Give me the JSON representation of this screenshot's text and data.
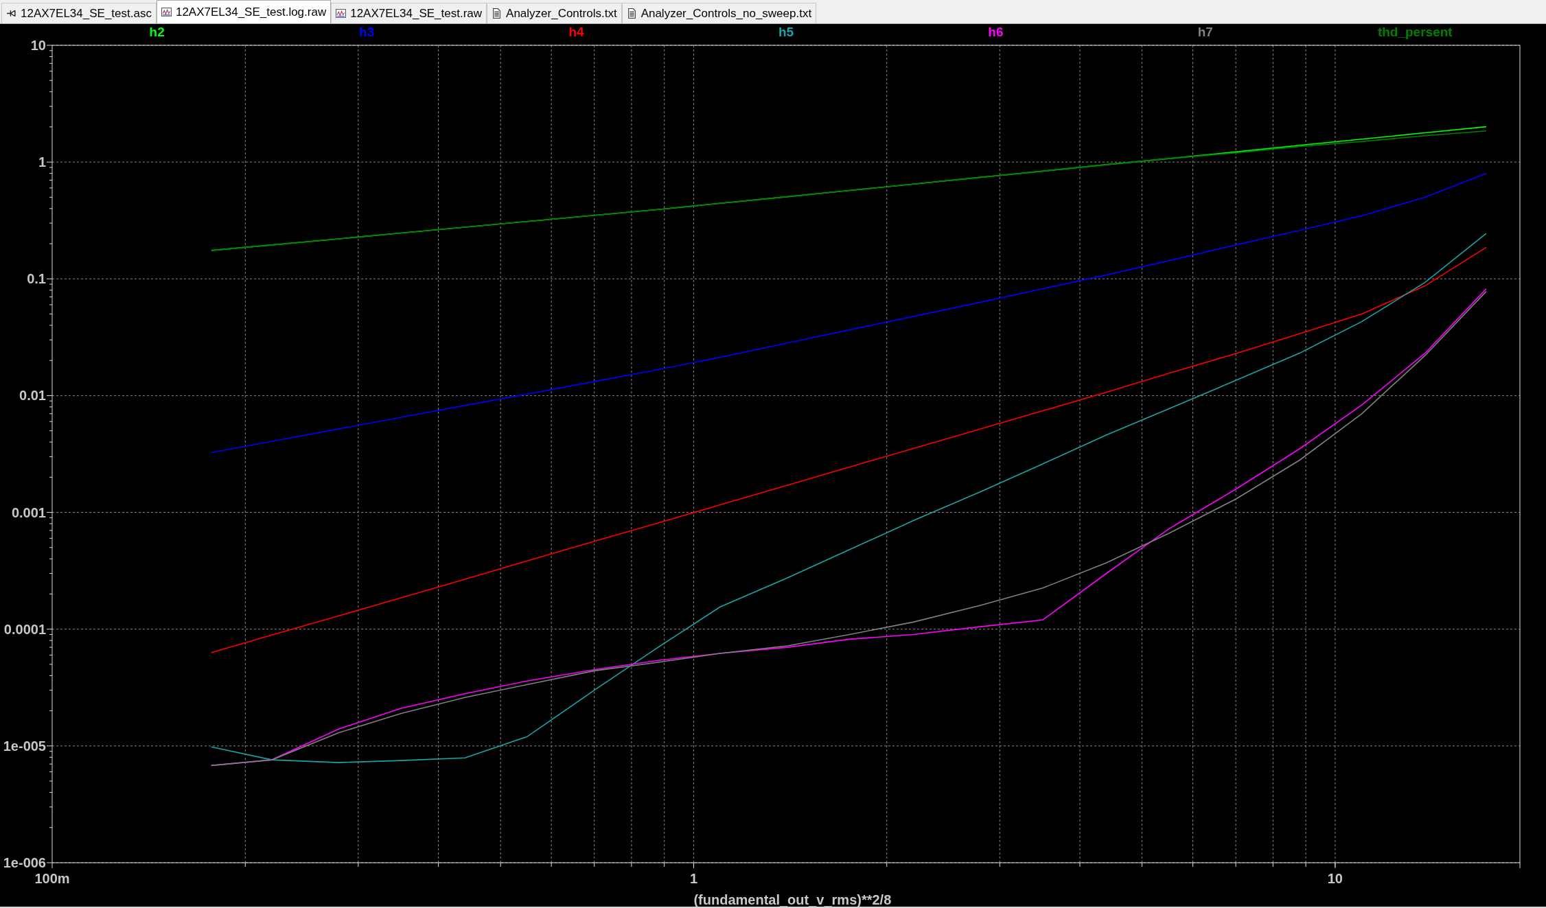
{
  "tabs": [
    {
      "label": "12AX7EL34_SE_test.asc",
      "kind": "schematic",
      "selected": false
    },
    {
      "label": "12AX7EL34_SE_test.log.raw",
      "kind": "waveform",
      "selected": true
    },
    {
      "label": "12AX7EL34_SE_test.raw",
      "kind": "waveform",
      "selected": false
    },
    {
      "label": "Analyzer_Controls.txt",
      "kind": "document",
      "selected": false
    },
    {
      "label": "Analyzer_Controls_no_sweep.txt",
      "kind": "document",
      "selected": false
    }
  ],
  "plot": {
    "legend": [
      {
        "name": "h2",
        "color": "#00ff00"
      },
      {
        "name": "h3",
        "color": "#0000ff"
      },
      {
        "name": "h4",
        "color": "#ff0000"
      },
      {
        "name": "h5",
        "color": "#19a5a5"
      },
      {
        "name": "h6",
        "color": "#ff00ff"
      },
      {
        "name": "h7",
        "color": "#808080"
      },
      {
        "name": "thd_persent",
        "color": "#008000"
      }
    ],
    "y_axis_labels": [
      "10",
      "1",
      "0.1",
      "0.01",
      "0.001",
      "0.0001",
      "1e-005",
      "1e-006"
    ],
    "x_axis_labels": [
      "100m",
      "1",
      "10"
    ],
    "x_axis_title": "(fundamental_out_v_rms)**2/8"
  }
}
